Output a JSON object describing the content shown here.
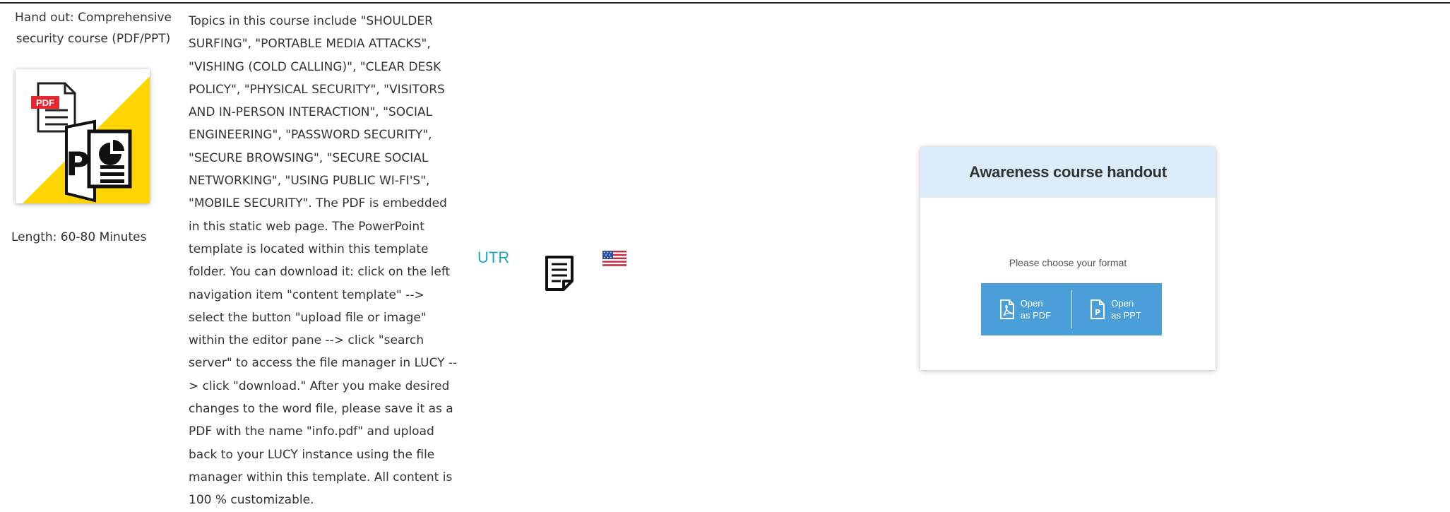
{
  "course": {
    "title": "Hand out: Comprehensive security course (PDF/PPT)",
    "thumbnail_icon": "pdf-ppt-icon",
    "thumbnail_badge": "PDF",
    "length": "Length: 60-80 Minutes"
  },
  "description": "Topics in this course include \"SHOULDER SURFING\", \"PORTABLE MEDIA ATTACKS\", \"VISHING (COLD CALLING)\", \"CLEAR DESK POLICY\", \"PHYSICAL SECURITY\", \"VISITORS AND IN-PERSON INTERACTION\", \"SOCIAL ENGINEERING\", \"PASSWORD SECURITY\", \"SECURE BROWSING\", \"SECURE SOCIAL NETWORKING\", \"USING PUBLIC WI-FI'S\", \"MOBILE SECURITY\". The PDF is embedded in this static web page. The PowerPoint template is located within this template folder. You can download it: click on the left navigation item \"content template\" --> select the button \"upload file or image\" within the editor pane --> click \"search server\" to access the file manager in LUCY --> click \"download.\" After you make desired changes to the word file, please save it as a PDF with the name \"info.pdf\" and upload back to your LUCY instance using the file manager within this template. All content is 100 % customizable.",
  "meta": {
    "utr_label": "UTR",
    "document_icon": "document-icon",
    "flag_icon": "us-flag-icon"
  },
  "handout": {
    "title": "Awareness course handout",
    "prompt": "Please choose your format",
    "pdf_button": "Open as PDF",
    "ppt_button": "Open as PPT",
    "accent_color": "#4a9fd9",
    "header_color": "#dcecfa"
  }
}
